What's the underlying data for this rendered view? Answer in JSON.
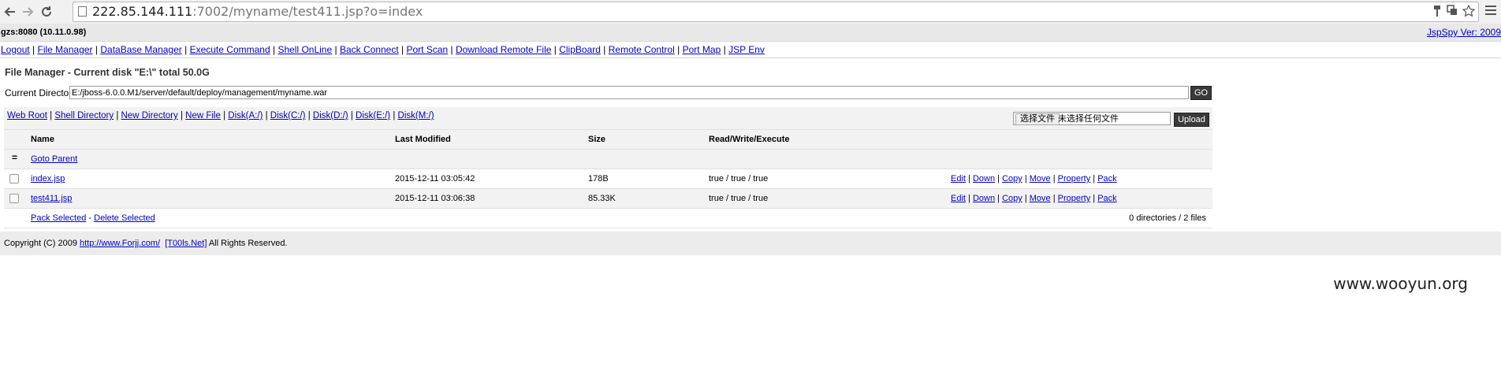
{
  "browser": {
    "url_host": "222.85.144.111",
    "url_rest": ":7002/myname/test411.jsp?o=index"
  },
  "header": {
    "host": "gzs:8080 (10.11.0.98)",
    "version_link": "JspSpy Ver: 2009"
  },
  "menu": {
    "items": [
      "Logout",
      "File Manager",
      "DataBase Manager",
      "Execute Command",
      "Shell OnLine",
      "Back Connect",
      "Port Scan",
      "Download Remote File",
      "ClipBoard",
      "Remote Control",
      "Port Map",
      "JSP Env"
    ],
    "separator": "|"
  },
  "file_manager": {
    "title": "File Manager - Current disk \"E:\\\" total 50.0G",
    "current_dir_label": "Current Directory",
    "current_dir_value": "E:/jboss-6.0.0.M1/server/default/deploy/management/myname.war",
    "go_label": "GO",
    "links": [
      "Web Root",
      "Shell Directory",
      "New Directory",
      "New File",
      "Disk(A:/)",
      "Disk(C:/)",
      "Disk(D:/)",
      "Disk(E:/)",
      "Disk(M:/)"
    ],
    "choose_file_label": "选择文件",
    "no_file_label": "未选择任何文件",
    "upload_label": "Upload",
    "columns": [
      "Name",
      "Last Modified",
      "Size",
      "Read/Write/Execute"
    ],
    "goto_parent_icon": "=",
    "goto_parent": "Goto Parent",
    "files": [
      {
        "name": "index.jsp",
        "modified": "2015-12-11 03:05:42",
        "size": "178B",
        "rwx": "true / true / true"
      },
      {
        "name": "test411.jsp",
        "modified": "2015-12-11 03:06:38",
        "size": "85.33K",
        "rwx": "true / true / true"
      }
    ],
    "actions": [
      "Edit",
      "Down",
      "Copy",
      "Move",
      "Property",
      "Pack"
    ],
    "pack_selected": "Pack Selected",
    "dash": "-",
    "delete_selected": "Delete Selected",
    "summary": "0 directories / 2 files"
  },
  "footer": {
    "prefix": "Copyright (C) 2009 ",
    "link1": "http://www.Forjj.com/",
    "link2": "[T00ls.Net]",
    "suffix": " All Rights Reserved."
  },
  "watermark": "www.wooyun.org"
}
